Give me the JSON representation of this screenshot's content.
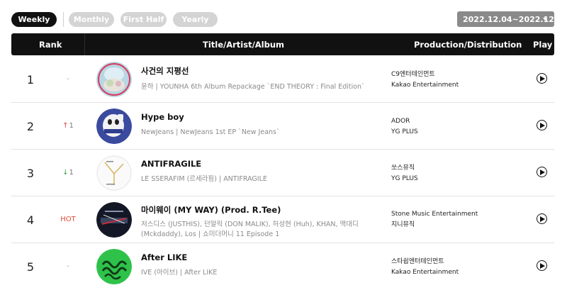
{
  "tabs": [
    {
      "label": "Weekly",
      "active": true
    },
    {
      "label": "Monthly",
      "active": false
    },
    {
      "label": "First Half",
      "active": false
    },
    {
      "label": "Yearly",
      "active": false
    }
  ],
  "date_range": "2022.12.04~2022.12.10",
  "header": {
    "rank": "Rank",
    "title": "Title/Artist/Album",
    "production": "Production/Distribution",
    "play": "Play"
  },
  "songs": [
    {
      "rank": "1",
      "change_type": "same",
      "change_text": "-",
      "title": "사건의 지평선",
      "subtitle": "윤하 | YOUNHA 6th Album Repackage `END THEORY : Final Edition`",
      "production": "C9엔터테인먼트",
      "distribution": "Kakao Entertainment"
    },
    {
      "rank": "2",
      "change_type": "up",
      "change_arrow": "↑",
      "change_text": "1",
      "title": "Hype boy",
      "subtitle": "NewJeans | NewJeans 1st EP `New Jeans`",
      "production": "ADOR",
      "distribution": "YG PLUS"
    },
    {
      "rank": "3",
      "change_type": "down",
      "change_arrow": "↓",
      "change_text": "1",
      "title": "ANTIFRAGILE",
      "subtitle": "LE SSERAFIM (르세라핌) | ANTIFRAGILE",
      "production": "쏘스뮤직",
      "distribution": "YG PLUS"
    },
    {
      "rank": "4",
      "change_type": "hot",
      "change_text": "HOT",
      "title": "마이웨이 (MY WAY) (Prod. R.Tee)",
      "subtitle": "저스디스 (JUSTHIS), 던말릭 (DON MALIK), 허성현 (Huh), KHAN, 맥대디 (Mckdaddy), Los | 쇼미더머니 11 Episode 1",
      "production": "Stone Music Entertainment",
      "distribution": "지니뮤직"
    },
    {
      "rank": "5",
      "change_type": "same",
      "change_text": "-",
      "title": "After LIKE",
      "subtitle": "IVE (아이브) | After LIKE",
      "production": "스타쉽엔터테인먼트",
      "distribution": "Kakao Entertainment"
    }
  ],
  "icons": {
    "play": "play-circle-icon",
    "dropdown": "chevron-down-icon"
  },
  "colors": {
    "header_bg": "#111111",
    "tab_active": "#111111",
    "tab_inactive": "#d4d4d4",
    "date_bg": "#8a8a8a",
    "up": "#e03b3b",
    "down": "#2f9e45",
    "hot": "#e04a3a"
  }
}
